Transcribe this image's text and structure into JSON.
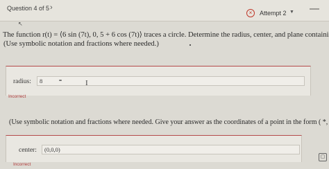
{
  "header": {
    "question_counter": "Question 4 of 5",
    "next_icon": "chevron-right-icon",
    "attempt_label": "Attempt 2",
    "attempt_icon": "x-circle-icon",
    "dropdown_icon": "chevron-down-icon"
  },
  "question": {
    "text": "The function r(t) = ⟨6 sin (7t), 0, 5 + 6 cos (7t)⟩ traces a circle. Determine the radius, center, and plane containing the circ",
    "instruction_1": "(Use symbolic notation and fractions where needed.)",
    "instruction_2": "(Use symbolic notation and fractions where needed. Give your answer as the coordinates of a point in the form ( *, *, * ))."
  },
  "radius_field": {
    "label": "radius:",
    "value": "8",
    "feedback": "Incorrect"
  },
  "center_field": {
    "label": "center:",
    "value": "(0,0,0)",
    "feedback": "Incorrect"
  },
  "colors": {
    "error": "#b03a3a",
    "panel_border": "#b44a4a",
    "background": "#dcdad3"
  }
}
